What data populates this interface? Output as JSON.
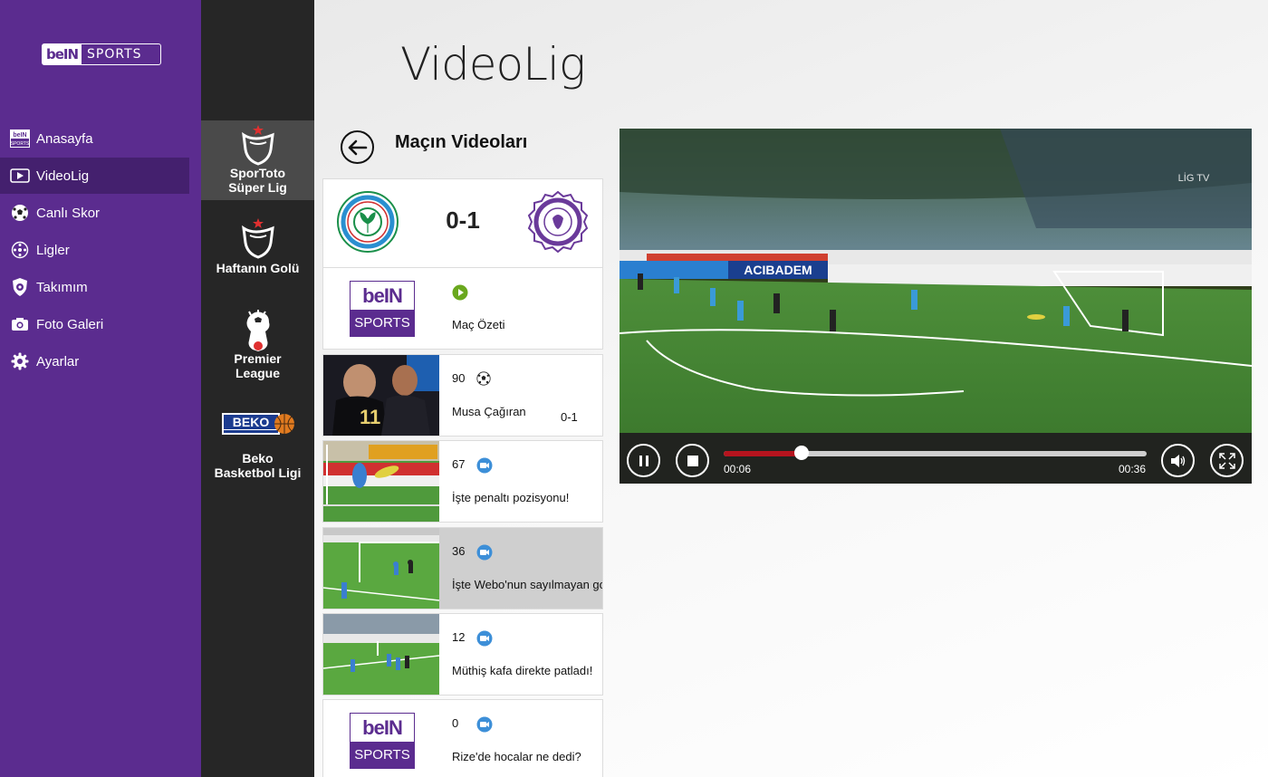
{
  "app": {
    "brand_left": "beIN",
    "brand_right": "SPORTS",
    "page_title": "VideoLig"
  },
  "sidebar": {
    "items": [
      {
        "label": "Anasayfa",
        "icon": "bein-icon",
        "active": false
      },
      {
        "label": "VideoLig",
        "icon": "play-icon",
        "active": true
      },
      {
        "label": "Canlı Skor",
        "icon": "soccer-ball-icon",
        "active": false
      },
      {
        "label": "Ligler",
        "icon": "dots-circle-icon",
        "active": false
      },
      {
        "label": "Takımım",
        "icon": "shield-ball-icon",
        "active": false
      },
      {
        "label": "Foto Galeri",
        "icon": "camera-icon",
        "active": false
      },
      {
        "label": "Ayarlar",
        "icon": "gear-icon",
        "active": false
      }
    ]
  },
  "leagues": {
    "items": [
      {
        "name_line1": "SporToto",
        "name_line2": "Süper Lig",
        "icon": "super-lig-icon",
        "active": true
      },
      {
        "name_line1": "Haftanın Golü",
        "name_line2": "",
        "icon": "super-lig-icon",
        "active": false
      },
      {
        "name_line1": "Premier",
        "name_line2": "League",
        "icon": "premier-league-lion-icon",
        "active": false
      },
      {
        "name_line1": "Beko",
        "name_line2": "Basketbol Ligi",
        "icon": "beko-basketball-icon",
        "active": false
      }
    ],
    "beko_logo_text": "BEKO"
  },
  "match": {
    "section_title": "Maçın Videoları",
    "score": "0-1",
    "home_logo": "caykur-rizespor-crest",
    "away_logo": "osmanlispor-crest"
  },
  "videos": [
    {
      "minute": "",
      "title": "Maç Özeti",
      "score": "",
      "type_icon": "play-green-icon",
      "thumb": "bein-sports-logo",
      "selected": false,
      "thumb_top": "beIN",
      "thumb_bottom": "SPORTS"
    },
    {
      "minute": "90",
      "title": "Musa Çağıran",
      "score": "0-1",
      "type_icon": "soccer-ball-icon",
      "thumb": "players-celebrating-photo",
      "selected": false
    },
    {
      "minute": "67",
      "title": "İşte penaltı pozisyonu!",
      "score": "",
      "type_icon": "video-camera-icon",
      "thumb": "penalty-save-photo",
      "selected": false
    },
    {
      "minute": "36",
      "title": "İşte Webo'nun sayılmayan golü",
      "score": "",
      "type_icon": "video-camera-icon",
      "thumb": "pitch-goal-photo",
      "selected": true
    },
    {
      "minute": "12",
      "title": "Müthiş kafa direkte patladı!",
      "score": "",
      "type_icon": "video-camera-icon",
      "thumb": "pitch-header-photo",
      "selected": false
    },
    {
      "minute": "0",
      "title": "Rize'de hocalar ne dedi?",
      "score": "",
      "type_icon": "video-camera-icon",
      "thumb": "bein-sports-logo",
      "selected": false,
      "thumb_top": "beIN",
      "thumb_bottom": "SPORTS"
    }
  ],
  "player": {
    "current_time": "00:06",
    "duration": "00:36",
    "progress": 0.185,
    "watermark": "LİG TV",
    "ad_board": "ACIBADEM",
    "colors": {
      "progress": "#b5141e",
      "pitch": "#4e8f3a"
    }
  },
  "colors": {
    "sidebar": "#5b2c8f",
    "sidebar_active": "#44206e",
    "leagues_bg": "#262626",
    "league_active": "#4a4a4a"
  }
}
